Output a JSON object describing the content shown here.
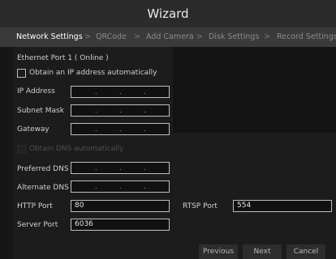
{
  "window": {
    "title": "Wizard"
  },
  "steps": {
    "items": [
      "Network Settings",
      "QRCode",
      "Add Camera",
      "Disk Settings",
      "Record Settings"
    ],
    "separator": ">",
    "active": "Network Settings"
  },
  "network": {
    "port_status": "Ethernet Port 1 ( Online )",
    "obtain_ip_label": "Obtain an IP address automatically",
    "obtain_ip_checked": false,
    "ip_label": "IP Address",
    "subnet_label": "Subnet Mask",
    "gateway_label": "Gateway",
    "ip_dot": ".",
    "obtain_dns_label": "Obtain DNS automatically",
    "obtain_dns_checked": false,
    "obtain_dns_enabled": false,
    "preferred_dns_label": "Preferred DNS",
    "alternate_dns_label": "Alternate DNS",
    "http_port_label": "HTTP Port",
    "http_port_value": "80",
    "rtsp_port_label": "RTSP Port",
    "rtsp_port_value": "554",
    "server_port_label": "Server Port",
    "server_port_value": "6036"
  },
  "buttons": {
    "previous": "Previous",
    "next": "Next",
    "cancel": "Cancel"
  }
}
